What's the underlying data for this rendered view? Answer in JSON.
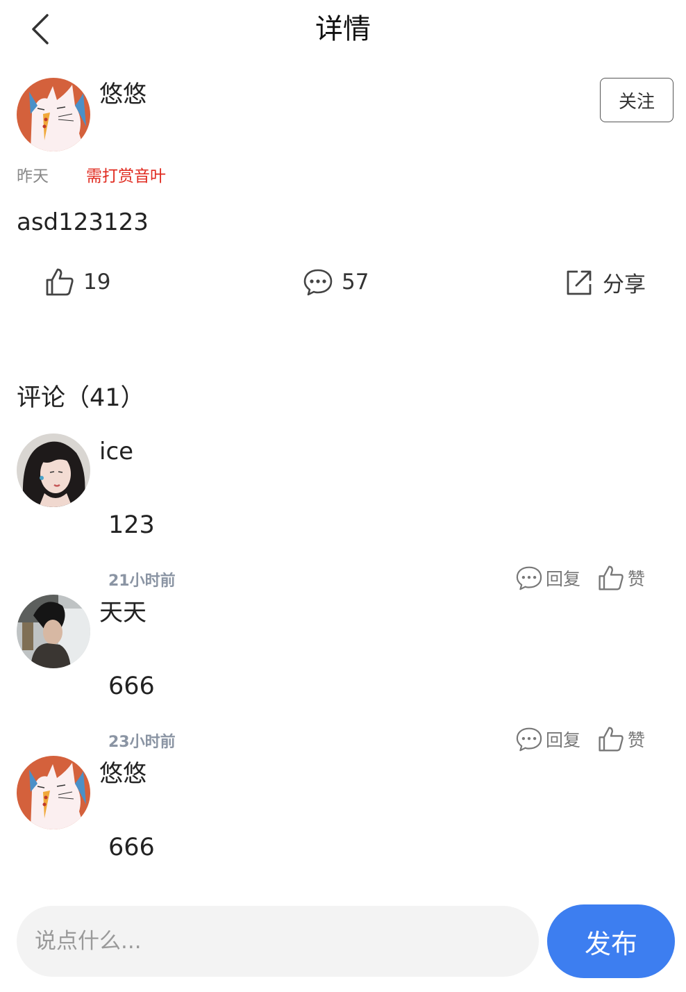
{
  "header": {
    "title": "详情"
  },
  "post": {
    "author": "悠悠",
    "follow_label": "关注",
    "time": "昨天",
    "reward_tag": "需打赏音叶",
    "content": "asd123123",
    "likes": "19",
    "comments": "57",
    "share_label": "分享"
  },
  "comments_section": {
    "title": "评论（41）",
    "items": [
      {
        "name": "ice",
        "text": "123",
        "time": "21小时前",
        "reply_label": "回复",
        "like_label": "赞",
        "avatar": "girl-portrait"
      },
      {
        "name": "天天",
        "text": "666",
        "time": "23小时前",
        "reply_label": "回复",
        "like_label": "赞",
        "avatar": "man-photo"
      },
      {
        "name": "悠悠",
        "text": "666",
        "avatar": "cat-illustration"
      }
    ]
  },
  "composer": {
    "placeholder": "说点什么...",
    "publish_label": "发布"
  },
  "colors": {
    "accent": "#3d7ef0",
    "reward": "#e02a1f",
    "avatar_bg": "#d4613c"
  },
  "icons": [
    "chevron-left-icon",
    "thumbs-up-icon",
    "comment-bubble-icon",
    "share-external-icon"
  ]
}
